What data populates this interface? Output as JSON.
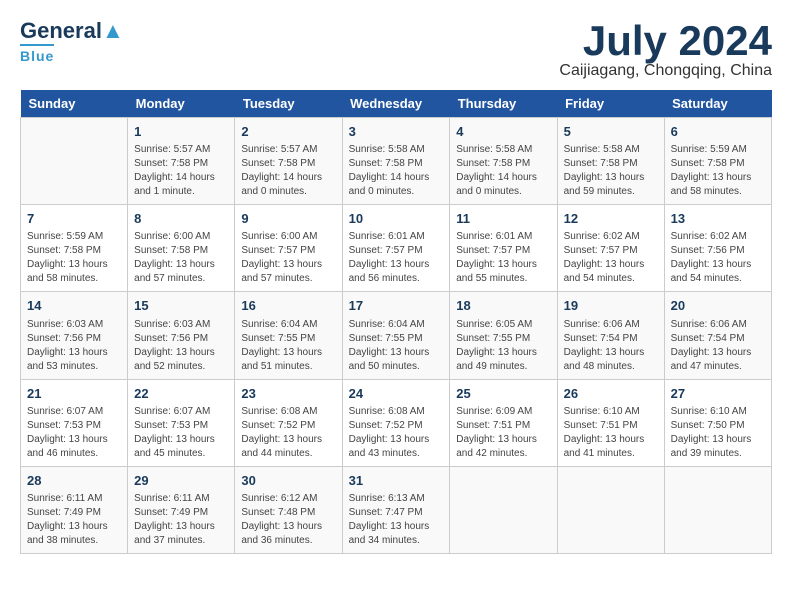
{
  "logo": {
    "general": "General",
    "blue": "Blue"
  },
  "title": {
    "month_year": "July 2024",
    "location": "Caijiagang, Chongqing, China"
  },
  "headers": [
    "Sunday",
    "Monday",
    "Tuesday",
    "Wednesday",
    "Thursday",
    "Friday",
    "Saturday"
  ],
  "weeks": [
    [
      {
        "day": "",
        "info": ""
      },
      {
        "day": "1",
        "info": "Sunrise: 5:57 AM\nSunset: 7:58 PM\nDaylight: 14 hours\nand 1 minute."
      },
      {
        "day": "2",
        "info": "Sunrise: 5:57 AM\nSunset: 7:58 PM\nDaylight: 14 hours\nand 0 minutes."
      },
      {
        "day": "3",
        "info": "Sunrise: 5:58 AM\nSunset: 7:58 PM\nDaylight: 14 hours\nand 0 minutes."
      },
      {
        "day": "4",
        "info": "Sunrise: 5:58 AM\nSunset: 7:58 PM\nDaylight: 14 hours\nand 0 minutes."
      },
      {
        "day": "5",
        "info": "Sunrise: 5:58 AM\nSunset: 7:58 PM\nDaylight: 13 hours\nand 59 minutes."
      },
      {
        "day": "6",
        "info": "Sunrise: 5:59 AM\nSunset: 7:58 PM\nDaylight: 13 hours\nand 58 minutes."
      }
    ],
    [
      {
        "day": "7",
        "info": "Sunrise: 5:59 AM\nSunset: 7:58 PM\nDaylight: 13 hours\nand 58 minutes."
      },
      {
        "day": "8",
        "info": "Sunrise: 6:00 AM\nSunset: 7:58 PM\nDaylight: 13 hours\nand 57 minutes."
      },
      {
        "day": "9",
        "info": "Sunrise: 6:00 AM\nSunset: 7:57 PM\nDaylight: 13 hours\nand 57 minutes."
      },
      {
        "day": "10",
        "info": "Sunrise: 6:01 AM\nSunset: 7:57 PM\nDaylight: 13 hours\nand 56 minutes."
      },
      {
        "day": "11",
        "info": "Sunrise: 6:01 AM\nSunset: 7:57 PM\nDaylight: 13 hours\nand 55 minutes."
      },
      {
        "day": "12",
        "info": "Sunrise: 6:02 AM\nSunset: 7:57 PM\nDaylight: 13 hours\nand 54 minutes."
      },
      {
        "day": "13",
        "info": "Sunrise: 6:02 AM\nSunset: 7:56 PM\nDaylight: 13 hours\nand 54 minutes."
      }
    ],
    [
      {
        "day": "14",
        "info": "Sunrise: 6:03 AM\nSunset: 7:56 PM\nDaylight: 13 hours\nand 53 minutes."
      },
      {
        "day": "15",
        "info": "Sunrise: 6:03 AM\nSunset: 7:56 PM\nDaylight: 13 hours\nand 52 minutes."
      },
      {
        "day": "16",
        "info": "Sunrise: 6:04 AM\nSunset: 7:55 PM\nDaylight: 13 hours\nand 51 minutes."
      },
      {
        "day": "17",
        "info": "Sunrise: 6:04 AM\nSunset: 7:55 PM\nDaylight: 13 hours\nand 50 minutes."
      },
      {
        "day": "18",
        "info": "Sunrise: 6:05 AM\nSunset: 7:55 PM\nDaylight: 13 hours\nand 49 minutes."
      },
      {
        "day": "19",
        "info": "Sunrise: 6:06 AM\nSunset: 7:54 PM\nDaylight: 13 hours\nand 48 minutes."
      },
      {
        "day": "20",
        "info": "Sunrise: 6:06 AM\nSunset: 7:54 PM\nDaylight: 13 hours\nand 47 minutes."
      }
    ],
    [
      {
        "day": "21",
        "info": "Sunrise: 6:07 AM\nSunset: 7:53 PM\nDaylight: 13 hours\nand 46 minutes."
      },
      {
        "day": "22",
        "info": "Sunrise: 6:07 AM\nSunset: 7:53 PM\nDaylight: 13 hours\nand 45 minutes."
      },
      {
        "day": "23",
        "info": "Sunrise: 6:08 AM\nSunset: 7:52 PM\nDaylight: 13 hours\nand 44 minutes."
      },
      {
        "day": "24",
        "info": "Sunrise: 6:08 AM\nSunset: 7:52 PM\nDaylight: 13 hours\nand 43 minutes."
      },
      {
        "day": "25",
        "info": "Sunrise: 6:09 AM\nSunset: 7:51 PM\nDaylight: 13 hours\nand 42 minutes."
      },
      {
        "day": "26",
        "info": "Sunrise: 6:10 AM\nSunset: 7:51 PM\nDaylight: 13 hours\nand 41 minutes."
      },
      {
        "day": "27",
        "info": "Sunrise: 6:10 AM\nSunset: 7:50 PM\nDaylight: 13 hours\nand 39 minutes."
      }
    ],
    [
      {
        "day": "28",
        "info": "Sunrise: 6:11 AM\nSunset: 7:49 PM\nDaylight: 13 hours\nand 38 minutes."
      },
      {
        "day": "29",
        "info": "Sunrise: 6:11 AM\nSunset: 7:49 PM\nDaylight: 13 hours\nand 37 minutes."
      },
      {
        "day": "30",
        "info": "Sunrise: 6:12 AM\nSunset: 7:48 PM\nDaylight: 13 hours\nand 36 minutes."
      },
      {
        "day": "31",
        "info": "Sunrise: 6:13 AM\nSunset: 7:47 PM\nDaylight: 13 hours\nand 34 minutes."
      },
      {
        "day": "",
        "info": ""
      },
      {
        "day": "",
        "info": ""
      },
      {
        "day": "",
        "info": ""
      }
    ]
  ]
}
